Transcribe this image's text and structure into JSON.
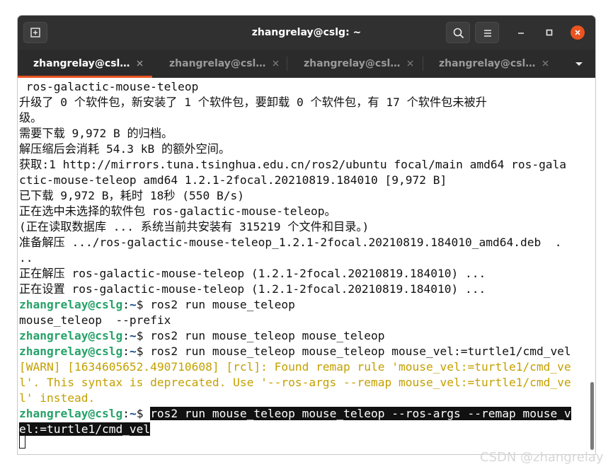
{
  "window": {
    "title": "zhangrelay@cslg: ~"
  },
  "tabs": [
    {
      "label": "zhangrelay@csl…",
      "active": true
    },
    {
      "label": "zhangrelay@csl…",
      "active": false
    },
    {
      "label": "zhangrelay@csl…",
      "active": false
    },
    {
      "label": "zhangrelay@csl…",
      "active": false
    }
  ],
  "icons": {
    "new_tab": "new-tab-icon",
    "search": "search-icon",
    "menu": "hamburger-menu-icon",
    "minimize": "minimize-icon",
    "maximize": "maximize-icon",
    "close": "close-icon",
    "tab_list": "chevron-down-icon"
  },
  "colors": {
    "accent": "#e95420",
    "titlebar": "#303030",
    "prompt_user": "#26a269",
    "prompt_path": "#12488b",
    "warning": "#c4a000"
  },
  "terminal": {
    "lines": [
      " ros-galactic-mouse-teleop",
      "升级了 0 个软件包，新安装了 1 个软件包，要卸载 0 个软件包，有 17 个软件包未被升",
      "级。",
      "需要下载 9,972 B 的归档。",
      "解压缩后会消耗 54.3 kB 的额外空间。",
      "获取:1 http://mirrors.tuna.tsinghua.edu.cn/ros2/ubuntu focal/main amd64 ros-gala",
      "ctic-mouse-teleop amd64 1.2.1-2focal.20210819.184010 [9,972 B]",
      "已下载 9,972 B，耗时 18秒 (550 B/s)",
      "正在选中未选择的软件包 ros-galactic-mouse-teleop。",
      "(正在读取数据库 ... 系统当前共安装有 315219 个文件和目录。)",
      "准备解压 .../ros-galactic-mouse-teleop_1.2.1-2focal.20210819.184010_amd64.deb  .",
      "..",
      "正在解压 ros-galactic-mouse-teleop (1.2.1-2focal.20210819.184010) ...",
      "正在设置 ros-galactic-mouse-teleop (1.2.1-2focal.20210819.184010) ..."
    ],
    "prompt_user": "zhangrelay@cslg",
    "prompt_sep": ":",
    "prompt_path": "~",
    "prompt_dollar": "$ ",
    "cmd1": "ros2 run mouse_teleop",
    "out1": "mouse_teleop  --prefix",
    "cmd2": "ros2 run mouse_teleop mouse_teleop",
    "cmd3": "ros2 run mouse_teleop mouse_teleop mouse_vel:=turtle1/cmd_vel",
    "warn_lines": [
      "[WARN] [1634605652.490710608] [rcl]: Found remap rule 'mouse_vel:=turtle1/cmd_ve",
      "l'. This syntax is deprecated. Use '--ros-args --remap mouse_vel:=turtle1/cmd_ve",
      "l' instead."
    ],
    "cmd4_part1": "ros2 run mouse_teleop mouse_teleop --ros-args --remap mouse_v",
    "cmd4_part2": "el:=turtle1/cmd_vel"
  },
  "watermark": "CSDN @zhangrelay"
}
